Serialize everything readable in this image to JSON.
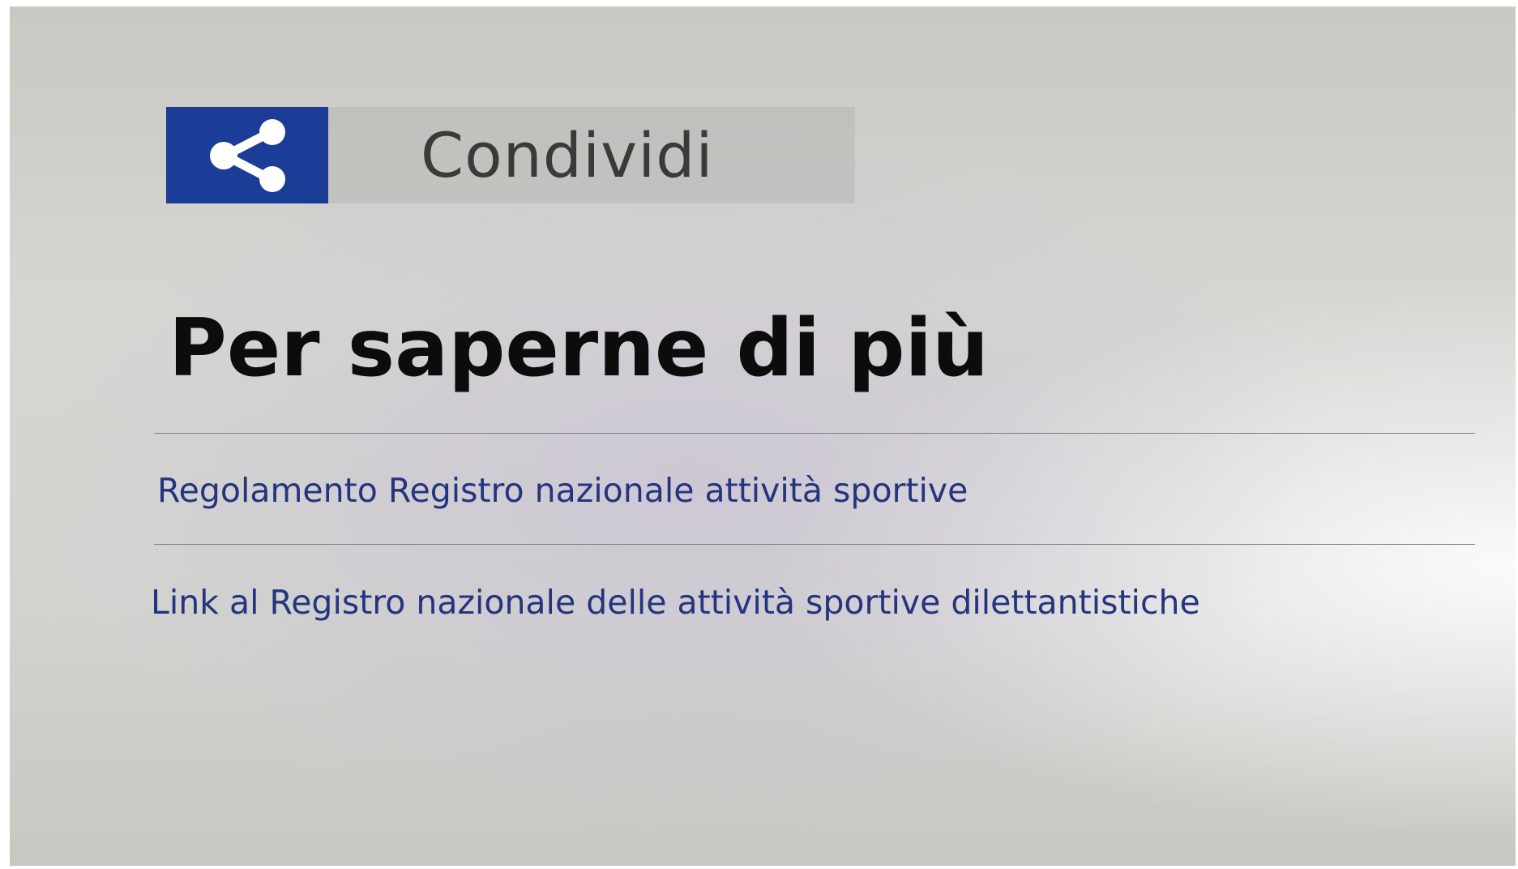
{
  "share": {
    "icon": "share-icon",
    "label": "Condividi",
    "icon_bg_color": "#1c3d97"
  },
  "section": {
    "title": "Per saperne di più"
  },
  "links": [
    {
      "label": "Regolamento Registro nazionale attività sportive"
    },
    {
      "label": "Link al Registro nazionale delle attività sportive dilettantistiche"
    }
  ],
  "colors": {
    "link": "#25347e",
    "title": "#0c0c0c"
  }
}
